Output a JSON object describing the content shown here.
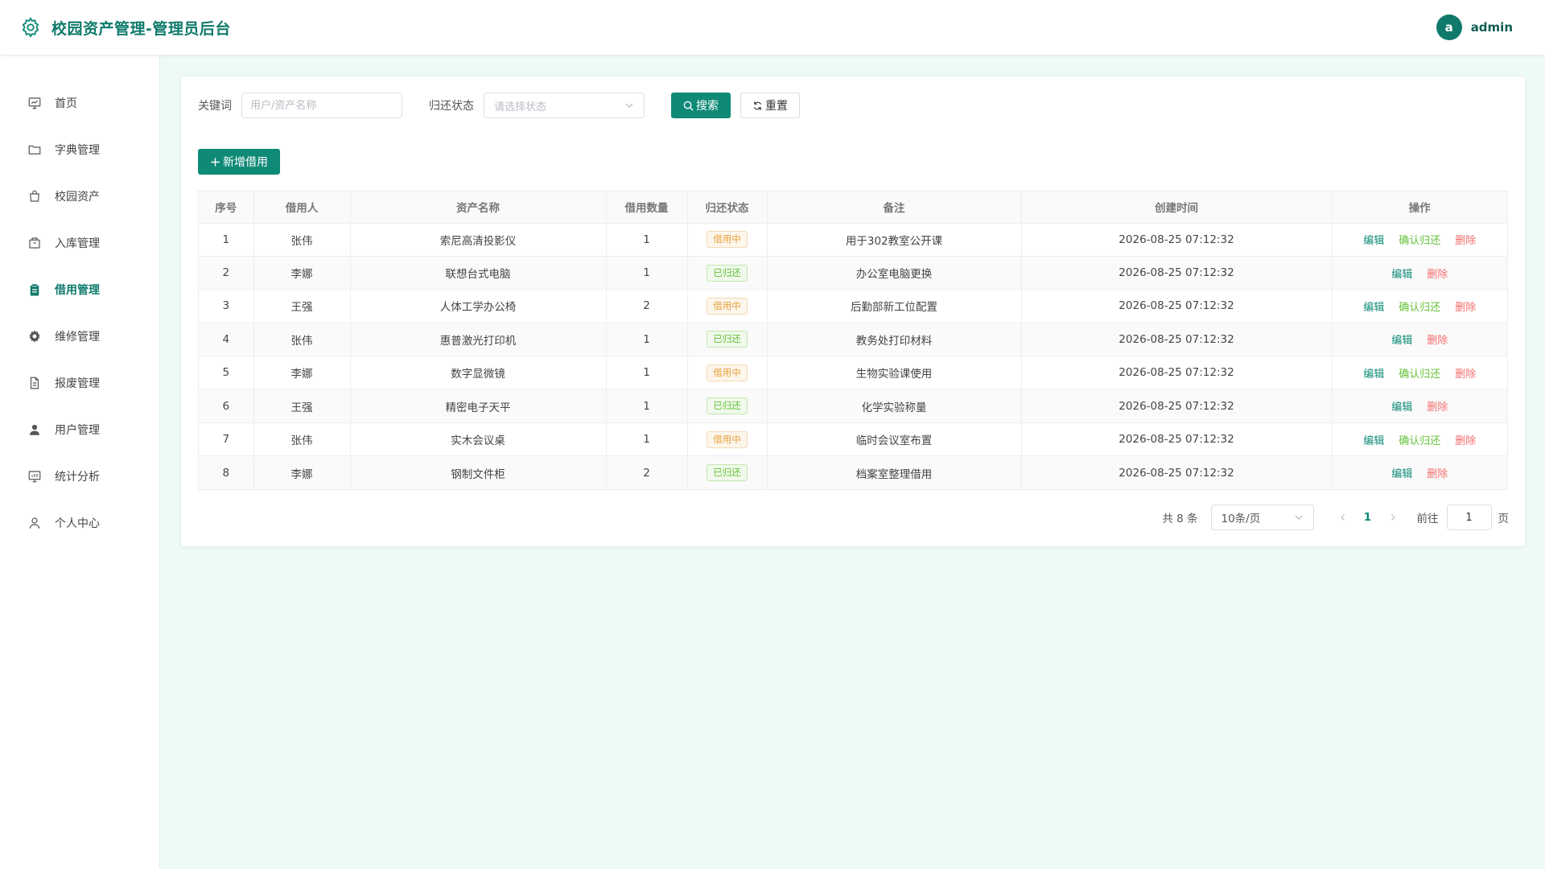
{
  "header": {
    "title": "校园资产管理-管理员后台",
    "avatar_letter": "a",
    "username": "admin"
  },
  "sidebar": {
    "items": [
      {
        "label": "首页",
        "icon": "dashboard-icon",
        "active": false
      },
      {
        "label": "字典管理",
        "icon": "folder-icon",
        "active": false
      },
      {
        "label": "校园资产",
        "icon": "bag-icon",
        "active": false
      },
      {
        "label": "入库管理",
        "icon": "box-icon",
        "active": false
      },
      {
        "label": "借用管理",
        "icon": "clipboard-icon",
        "active": true
      },
      {
        "label": "维修管理",
        "icon": "gear-icon",
        "active": false
      },
      {
        "label": "报废管理",
        "icon": "document-icon",
        "active": false
      },
      {
        "label": "用户管理",
        "icon": "user-solid-icon",
        "active": false
      },
      {
        "label": "统计分析",
        "icon": "chart-icon",
        "active": false
      },
      {
        "label": "个人中心",
        "icon": "user-outline-icon",
        "active": false
      }
    ]
  },
  "search": {
    "keyword_label": "关键词",
    "keyword_placeholder": "用户/资产名称",
    "status_label": "归还状态",
    "status_placeholder": "请选择状态",
    "search_button": "搜索",
    "reset_button": "重置"
  },
  "actions": {
    "add_button": "新增借用"
  },
  "table": {
    "columns": [
      "序号",
      "借用人",
      "资产名称",
      "借用数量",
      "归还状态",
      "备注",
      "创建时间",
      "操作"
    ],
    "rows": [
      {
        "no": "1",
        "borrower": "张伟",
        "asset": "索尼高清投影仪",
        "qty": "1",
        "status": "借用中",
        "status_type": "lending",
        "remark": "用于302教室公开课",
        "created": "2026-08-25 07:12:32"
      },
      {
        "no": "2",
        "borrower": "李娜",
        "asset": "联想台式电脑",
        "qty": "1",
        "status": "已归还",
        "status_type": "returned",
        "remark": "办公室电脑更换",
        "created": "2026-08-25 07:12:32"
      },
      {
        "no": "3",
        "borrower": "王强",
        "asset": "人体工学办公椅",
        "qty": "2",
        "status": "借用中",
        "status_type": "lending",
        "remark": "后勤部新工位配置",
        "created": "2026-08-25 07:12:32"
      },
      {
        "no": "4",
        "borrower": "张伟",
        "asset": "惠普激光打印机",
        "qty": "1",
        "status": "已归还",
        "status_type": "returned",
        "remark": "教务处打印材料",
        "created": "2026-08-25 07:12:32"
      },
      {
        "no": "5",
        "borrower": "李娜",
        "asset": "数字显微镜",
        "qty": "1",
        "status": "借用中",
        "status_type": "lending",
        "remark": "生物实验课使用",
        "created": "2026-08-25 07:12:32"
      },
      {
        "no": "6",
        "borrower": "王强",
        "asset": "精密电子天平",
        "qty": "1",
        "status": "已归还",
        "status_type": "returned",
        "remark": "化学实验称量",
        "created": "2026-08-25 07:12:32"
      },
      {
        "no": "7",
        "borrower": "张伟",
        "asset": "实木会议桌",
        "qty": "1",
        "status": "借用中",
        "status_type": "lending",
        "remark": "临时会议室布置",
        "created": "2026-08-25 07:12:32"
      },
      {
        "no": "8",
        "borrower": "李娜",
        "asset": "钢制文件柜",
        "qty": "2",
        "status": "已归还",
        "status_type": "returned",
        "remark": "档案室整理借用",
        "created": "2026-08-25 07:12:32"
      }
    ],
    "op_edit": "编辑",
    "op_confirm": "确认归还",
    "op_delete": "删除"
  },
  "pagination": {
    "total_text": "共 8 条",
    "page_size": "10条/页",
    "current_page": "1",
    "goto_label": "前往",
    "goto_value": "1",
    "page_unit": "页"
  },
  "colors": {
    "accent": "#0f8a77",
    "lending": "#e6a23c",
    "returned": "#67c23a",
    "danger": "#f56c6c"
  }
}
